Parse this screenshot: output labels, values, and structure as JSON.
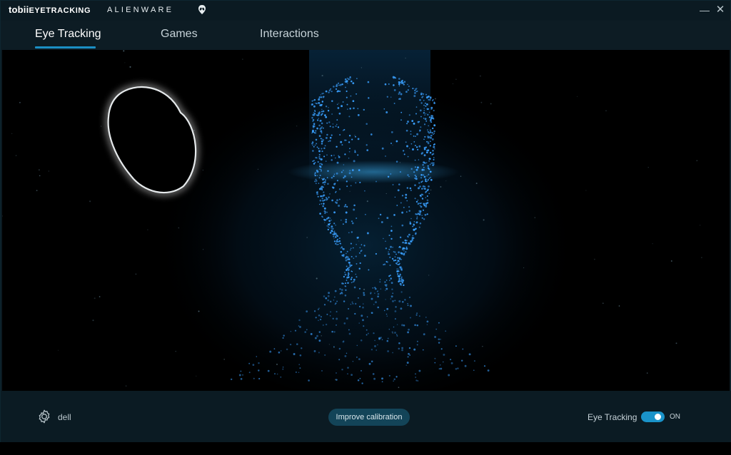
{
  "titlebar": {
    "brand_tobii": "tobii",
    "brand_suffix": "EYETRACKING",
    "partner": "ALIENWARE",
    "minimize_symbol": "—",
    "close_symbol": "✕"
  },
  "tabs": [
    {
      "label": "Eye Tracking",
      "active": true
    },
    {
      "label": "Games",
      "active": false
    },
    {
      "label": "Interactions",
      "active": false
    }
  ],
  "footer": {
    "user_name": "dell",
    "calibrate_label": "Improve calibration",
    "eye_tracking_label": "Eye Tracking",
    "toggle_state": "ON",
    "toggle_on": true
  },
  "colors": {
    "accent": "#1b8fc4",
    "background": "#0b1a22",
    "particle": "#3aa0ff"
  },
  "icons": {
    "settings": "gear-icon",
    "alienware": "alien-head-icon"
  }
}
